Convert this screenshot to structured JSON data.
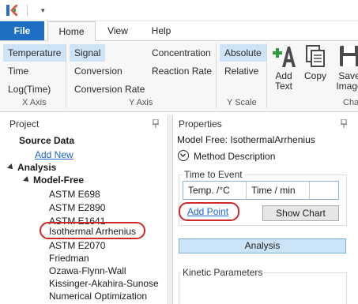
{
  "quick_access": {
    "dropdown_glyph": "▾"
  },
  "tabs": {
    "file": "File",
    "home": "Home",
    "view": "View",
    "help": "Help"
  },
  "ribbon": {
    "x_axis": {
      "label": "X Axis",
      "items": [
        "Temperature",
        "Time",
        "Log(Time)"
      ],
      "selected": "Temperature"
    },
    "y_axis": {
      "label": "Y Axis",
      "col1": [
        "Signal",
        "Conversion",
        "Conversion Rate"
      ],
      "col2": [
        "Concentration",
        "Reaction Rate"
      ],
      "selected": "Signal"
    },
    "y_scale": {
      "label": "Y Scale",
      "items": [
        "Absolute",
        "Relative"
      ],
      "selected": "Absolute"
    },
    "add_text": {
      "line1": "Add",
      "line2": "Text"
    },
    "copy": "Copy",
    "save_image": {
      "line1": "Save",
      "line2": "Image"
    },
    "chart_group_label": "Cha"
  },
  "project": {
    "header": "Project",
    "source_data": "Source Data",
    "add_new": "Add New",
    "analysis": "Analysis",
    "model_free": "Model-Free",
    "methods": [
      "ASTM E698",
      "ASTM E2890",
      "ASTM E1641",
      "Isothermal Arrhenius",
      "ASTM E2070",
      "Friedman",
      "Ozawa-Flynn-Wall",
      "Kissinger-Akahira-Sunose",
      "Numerical Optimization"
    ],
    "selected_method": "Isothermal Arrhenius"
  },
  "properties": {
    "header": "Properties",
    "model_title": "Model Free: IsothermalArrhenius",
    "method_description": "Method Description",
    "time_to_event": "Time to Event",
    "columns": [
      "Temp. /°C",
      "Time / min"
    ],
    "add_point": "Add Point",
    "show_chart": "Show Chart",
    "analysis_button": "Analysis",
    "kinetic_parameters": "Kinetic Parameters"
  },
  "colors": {
    "accent": "#1e6fc4",
    "selection": "#cfe3f6",
    "highlight_oval": "#d0282b",
    "link": "#1e64c8"
  }
}
